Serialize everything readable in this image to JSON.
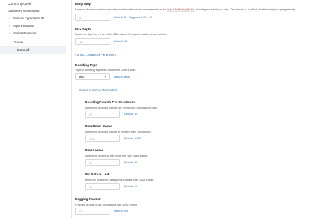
{
  "sidebar": {
    "items": [
      {
        "label": "Commonly Used",
        "chevron": "",
        "selected": false
      },
      {
        "label": "Dataset Preprocessing",
        "chevron": "",
        "selected": false
      },
      {
        "label": "Feature Type Defaults",
        "chevron": "›",
        "selected": false
      },
      {
        "label": "Input Features",
        "chevron": "›",
        "selected": false
      },
      {
        "label": "Output Features",
        "chevron": "›",
        "selected": false
      },
      {
        "label": "Trainer",
        "chevron": "⌄",
        "selected": false
      },
      {
        "label": "General",
        "chevron": "",
        "selected": true
      }
    ]
  },
  "early_stop": {
    "label": "Early Stop",
    "desc_before": "Number of consecutive rounds of evaluation without any improvement on the ",
    "desc_code": "validation_metric",
    "desc_after": " that triggers training to stop. Can be set to -1, which disables early stopping entirely.",
    "value": "5",
    "default": "Default: 5",
    "suggested": "Suggested: 5 ... 10"
  },
  "max_depth": {
    "label": "Max Depth",
    "desc": "Maximum depth of a tree in the GBM trainer. A negative value means no limit.",
    "value": "18",
    "default": "Default: 18"
  },
  "advanced_toggle_1": {
    "icon": "›",
    "label": "Show 2 Advanced Parameters"
  },
  "boosting_type": {
    "label": "Boosting Type",
    "desc": "Type of boosting algorithm to use with GBM trainer.",
    "value": "gbdt",
    "default": "Default: gbdt"
  },
  "advanced_toggle_2": {
    "icon": "⌄",
    "label": "Show 4 Advanced Parameters"
  },
  "boosting_rounds": {
    "label": "Boosting Rounds Per Checkpoint",
    "desc": "Number of boosting rounds per checkpoint / evaluation round.",
    "value": "50",
    "default": "Default: 50"
  },
  "num_boost_round": {
    "label": "Num Boost Round",
    "desc": "Number of boosting rounds to perform with GBM trainer.",
    "value": "1000",
    "default": "Default: 1000"
  },
  "num_leaves": {
    "label": "Num Leaves",
    "desc": "Number of leaves to use in the tree with GBM trainer.",
    "value": "82",
    "default": "Default: 82"
  },
  "min_data_in_leaf": {
    "label": "Min Data In Leaf",
    "desc": "Minimum number of data points in a leaf with GBM trainer.",
    "value": "20",
    "default": "Default: 20"
  },
  "bagging_fraction": {
    "label": "Bagging Fraction",
    "desc": "Fraction of data to use for bagging with GBM trainer.",
    "value": "0.8",
    "default": "Default: 0.8"
  }
}
